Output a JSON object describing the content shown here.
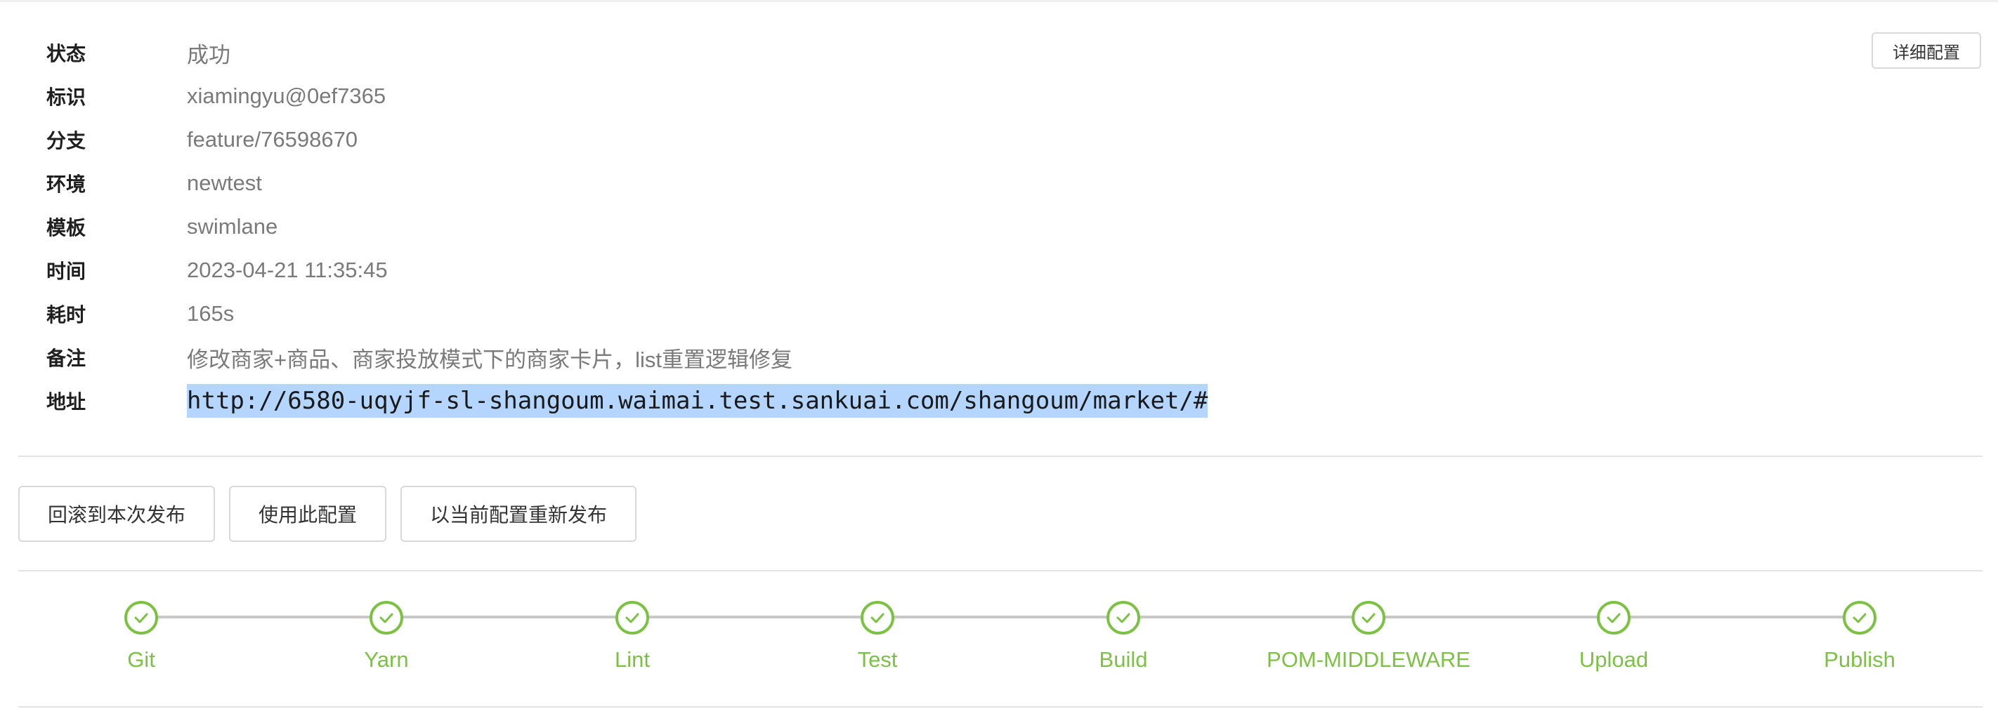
{
  "info": {
    "status": {
      "label": "状态",
      "value": "成功"
    },
    "identifier": {
      "label": "标识",
      "value": "xiamingyu@0ef7365"
    },
    "branch": {
      "label": "分支",
      "value": "feature/76598670"
    },
    "environment": {
      "label": "环境",
      "value": "newtest"
    },
    "template": {
      "label": "模板",
      "value": "swimlane"
    },
    "time": {
      "label": "时间",
      "value": "2023-04-21 11:35:45"
    },
    "duration": {
      "label": "耗时",
      "value": "165s"
    },
    "remark": {
      "label": "备注",
      "value": "修改商家+商品、商家投放模式下的商家卡片，list重置逻辑修复"
    },
    "address": {
      "label": "地址",
      "value": "http://6580-uqyjf-sl-shangoum.waimai.test.sankuai.com/shangoum/market/#"
    }
  },
  "buttons": {
    "detail_config": "详细配置",
    "rollback": "回滚到本次发布",
    "use_config": "使用此配置",
    "redeploy": "以当前配置重新发布"
  },
  "pipeline": {
    "status_color": "#7cc242",
    "steps": [
      {
        "label": "Git",
        "status": "success",
        "icon": "check-circle-icon"
      },
      {
        "label": "Yarn",
        "status": "success",
        "icon": "check-circle-icon"
      },
      {
        "label": "Lint",
        "status": "success",
        "icon": "check-circle-icon"
      },
      {
        "label": "Test",
        "status": "success",
        "icon": "check-circle-icon"
      },
      {
        "label": "Build",
        "status": "success",
        "icon": "check-circle-icon"
      },
      {
        "label": "POM-MIDDLEWARE",
        "status": "success",
        "icon": "check-circle-icon"
      },
      {
        "label": "Upload",
        "status": "success",
        "icon": "check-circle-icon"
      },
      {
        "label": "Publish",
        "status": "success",
        "icon": "check-circle-icon"
      }
    ]
  }
}
